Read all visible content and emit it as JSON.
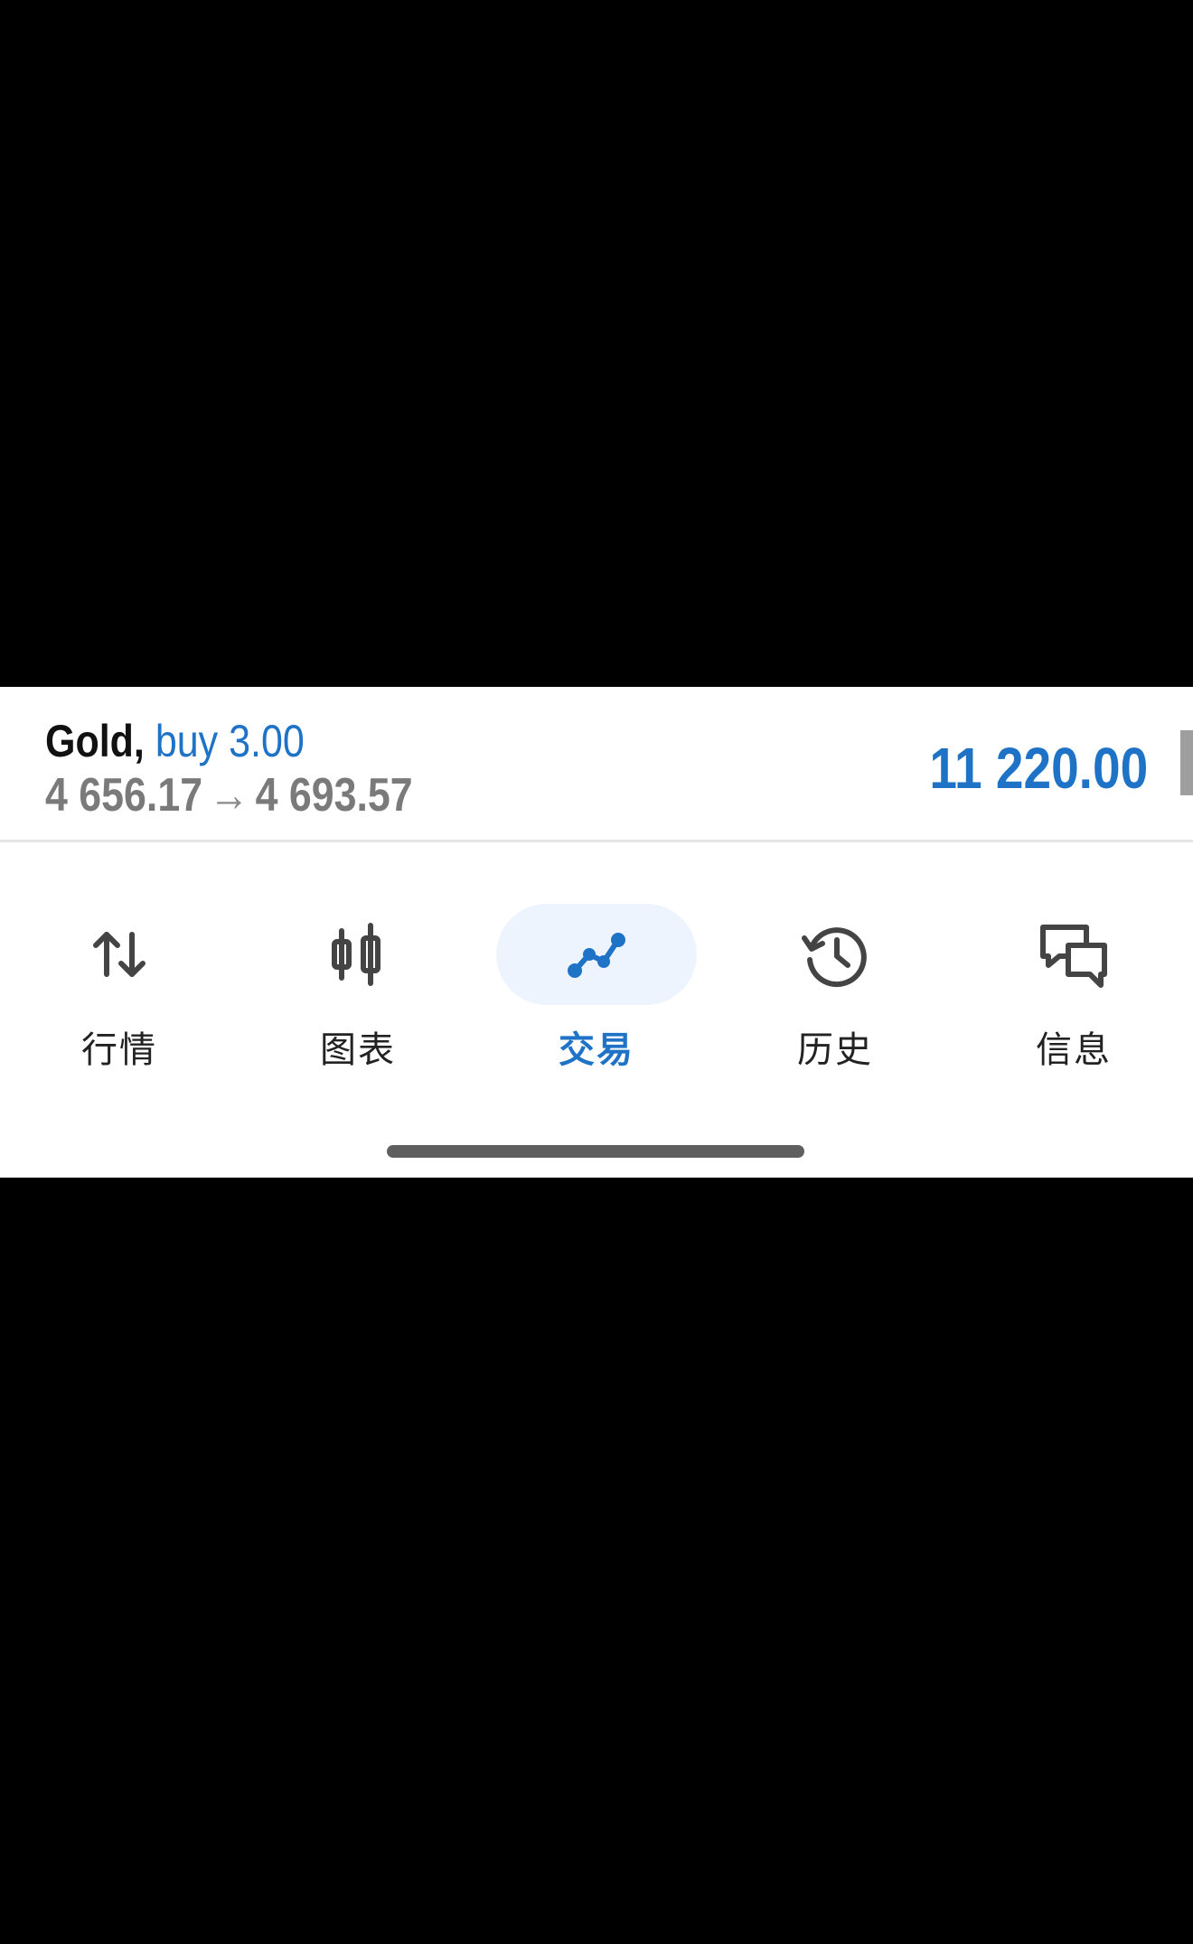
{
  "trade": {
    "symbol": "Gold,",
    "side": "buy 3.00",
    "open_price": "4 656.17",
    "arrow": "→",
    "current_price": "4 693.57",
    "profit": "11 220.00"
  },
  "nav": {
    "items": [
      {
        "label": "行情",
        "icon": "arrows-up-down-icon",
        "active": false
      },
      {
        "label": "图表",
        "icon": "candlestick-icon",
        "active": false
      },
      {
        "label": "交易",
        "icon": "trend-line-icon",
        "active": true
      },
      {
        "label": "历史",
        "icon": "history-clock-icon",
        "active": false
      },
      {
        "label": "信息",
        "icon": "chat-bubbles-icon",
        "active": false
      }
    ]
  },
  "colors": {
    "accent": "#1f73c7",
    "active_bg": "#eef4fd",
    "muted_text": "#7a7a7a",
    "icon_dark": "#444444"
  }
}
